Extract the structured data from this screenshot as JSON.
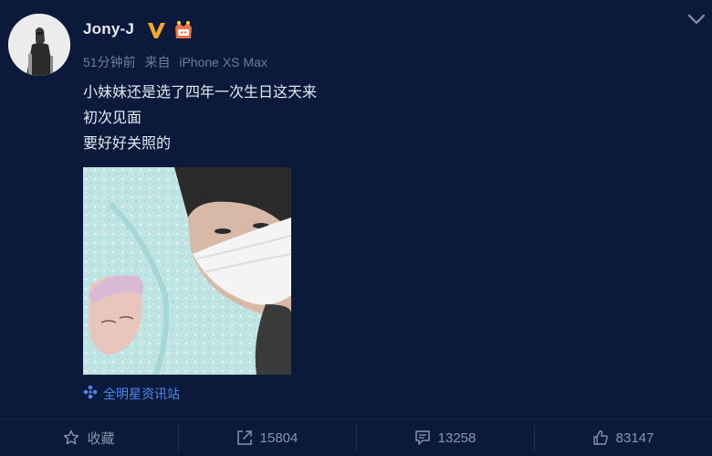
{
  "post": {
    "username": "Jony-J",
    "time": "51分钟前",
    "source_prefix": "来自",
    "source_device": "iPhone XS Max",
    "content_lines": [
      "小妹妹还是选了四年一次生日这天来",
      "初次见面",
      "要好好关照的"
    ],
    "attribution": "全明星资讯站"
  },
  "actions": {
    "favorite_label": "收藏",
    "repost_count": "15804",
    "comment_count": "13258",
    "like_count": "83147"
  },
  "icons": {
    "verified": "verified-v-icon",
    "vip": "vip-crown-icon",
    "menu": "chevron-down-icon",
    "attribution": "pinwheel-icon",
    "favorite": "star-icon",
    "repost": "share-arrow-icon",
    "comment": "comment-bubble-icon",
    "like": "thumbs-up-icon"
  },
  "colors": {
    "background": "#0b1a3a",
    "verified": "#f5a623",
    "vip": "#f2734a",
    "link": "#4f86e8",
    "muted": "#6f7d9a"
  }
}
